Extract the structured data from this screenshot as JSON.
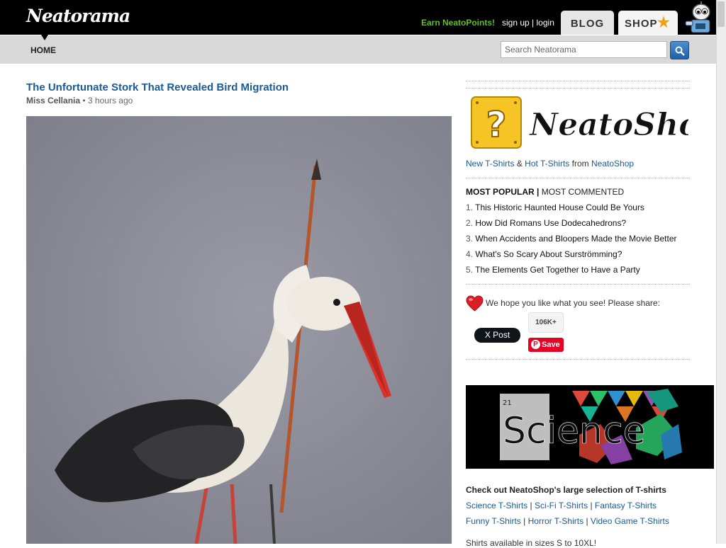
{
  "header": {
    "logo_text": "Neatorama",
    "earn_label": "Earn NeatoPoints!",
    "signup_label": "sign up",
    "separator": "|",
    "login_label": "login",
    "blog_tab": "BLOG",
    "shop_tab": "SHOP",
    "shop_tab_icon": "star-icon",
    "mascot_icon": "robot-mascot-icon",
    "brand_color": "#000000",
    "earn_color": "#5fbf2a"
  },
  "nav": {
    "home_label": "HOME",
    "search_placeholder": "Search Neatorama",
    "search_icon": "magnifier-icon"
  },
  "article": {
    "title": "The Unfortunate Stork That Revealed Bird Migration",
    "author": "Miss Cellania",
    "bullet": "•",
    "time": "3 hours ago",
    "image_alt": "stork-with-arrow-photo"
  },
  "sidebar": {
    "neatoshop_banner_text": "NeatoShop",
    "shirts_line": {
      "new_label": "New T-Shirts",
      "amp": "&",
      "hot_label": "Hot T-Shirts",
      "from": "from",
      "shop_label": "NeatoShop"
    },
    "popular": {
      "active_tab": "MOST POPULAR",
      "divider": "|",
      "other_tab": "MOST COMMENTED",
      "items": [
        {
          "num": "1.",
          "title": "This Historic Haunted House Could Be Yours"
        },
        {
          "num": "2.",
          "title": "How Did Romans Use Dodecahedrons?"
        },
        {
          "num": "3.",
          "title": "When Accidents and Bloopers Made the Movie Better"
        },
        {
          "num": "4.",
          "title": "What's So Scary About Surströmming?"
        },
        {
          "num": "5.",
          "title": "The Elements Get Together to Have a Party"
        }
      ]
    },
    "share": {
      "text": "We hope you like what you see! Please share:",
      "count": "106K+",
      "x_post_label": "X Post",
      "save_label": "Save",
      "heart_color": "#d81f26"
    },
    "science_ad": {
      "element_number": "21",
      "word": "Science"
    },
    "shirts_promo": {
      "heading": "Check out NeatoShop's large selection of T-shirts",
      "row1": [
        "Science T-Shirts",
        "Sci-Fi T-Shirts",
        "Fantasy T-Shirts"
      ],
      "row2": [
        "Funny T-Shirts",
        "Horror T-Shirts",
        "Video Game T-Shirts"
      ],
      "sep": "|",
      "sizes": "Shirts available in sizes S to 10XL!"
    }
  }
}
